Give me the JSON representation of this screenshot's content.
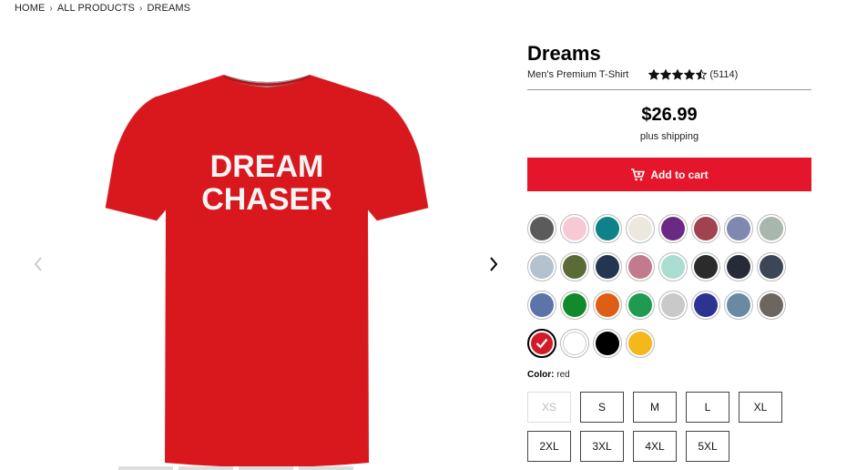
{
  "breadcrumb": {
    "items": [
      "HOME",
      "ALL PRODUCTS",
      "DREAMS"
    ]
  },
  "product": {
    "title": "Dreams",
    "subtitle": "Men's Premium T-Shirt",
    "rating": 4.5,
    "reviews": "(5114)",
    "price": "$26.99",
    "shipping": "plus shipping",
    "add_to_cart": "Add to cart",
    "shirt_print": [
      "DREAM",
      "CHASER"
    ],
    "shirt_color": "#d9181e"
  },
  "colors": [
    "#5b5b5b",
    "#f7c9d4",
    "#0f8189",
    "#ede8df",
    "#6a2a83",
    "#a0424f",
    "#7f88b0",
    "#a8b6ad",
    "#b4c1cf",
    "#5b6b36",
    "#243551",
    "#c27a8c",
    "#a9ded0",
    "#2b2b2b",
    "#272a38",
    "#3b4656",
    "#5c75a8",
    "#128a2b",
    "#e05d14",
    "#1f9b51",
    "#c9c9c9",
    "#2c3390",
    "#6a8aa3",
    "#6b6760",
    "#d21a29",
    "#ffffff",
    "#000000",
    "#f5b81b"
  ],
  "selected_color_index": 24,
  "color_label": {
    "prefix": "Color:",
    "value": "red"
  },
  "sizes": [
    {
      "label": "XS",
      "available": false
    },
    {
      "label": "S",
      "available": true
    },
    {
      "label": "M",
      "available": true
    },
    {
      "label": "L",
      "available": true
    },
    {
      "label": "XL",
      "available": true
    },
    {
      "label": "2XL",
      "available": true
    },
    {
      "label": "3XL",
      "available": true
    },
    {
      "label": "4XL",
      "available": true
    },
    {
      "label": "5XL",
      "available": true
    }
  ]
}
